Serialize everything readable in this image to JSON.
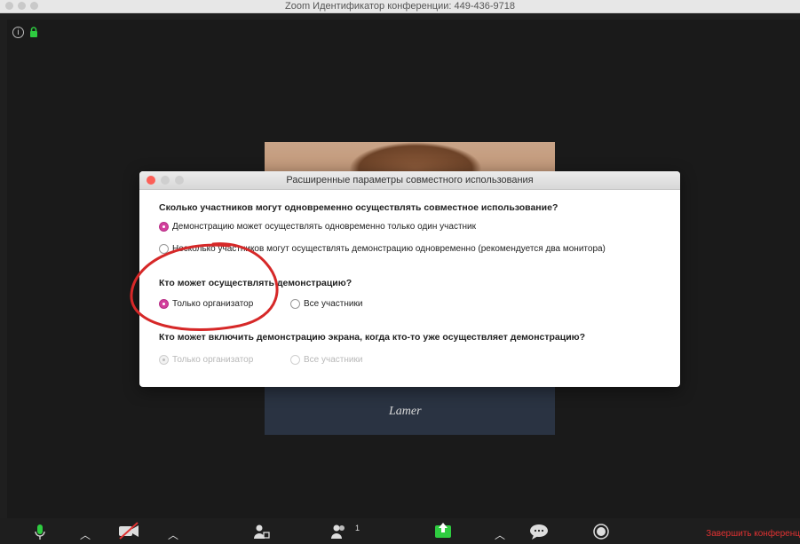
{
  "window": {
    "title": "Zoom Идентификатор конференции: 449-436-9718"
  },
  "dialog": {
    "title": "Расширенные параметры совместного использования",
    "q1": {
      "label": "Сколько участников могут одновременно осуществлять совместное использование?",
      "opt1": "Демонстрацию может осуществлять одновременно только один участник",
      "opt2": "Несколько участников могут осуществлять демонстрацию одновременно (рекомендуется два монитора)"
    },
    "q2": {
      "label": "Кто может осуществлять демонстрацию?",
      "opt1": "Только организатор",
      "opt2": "Все участники"
    },
    "q3": {
      "label": "Кто может включить демонстрацию экрана, когда кто-то уже осуществляет демонстрацию?",
      "opt1": "Только организатор",
      "opt2": "Все участники"
    }
  },
  "video": {
    "shirt_text": "Lamer"
  },
  "toolbar": {
    "participants_count": "1",
    "end_label": "Завершить конференц"
  },
  "colors": {
    "accent": "#d23f9c",
    "annotation": "#d62828",
    "end": "#e03232",
    "share": "#2ecc40"
  },
  "icons": [
    "info-icon",
    "lock-icon",
    "mic-icon",
    "video-off-icon",
    "manage-participants-icon",
    "participants-icon",
    "share-screen-icon",
    "chat-icon",
    "record-icon"
  ]
}
